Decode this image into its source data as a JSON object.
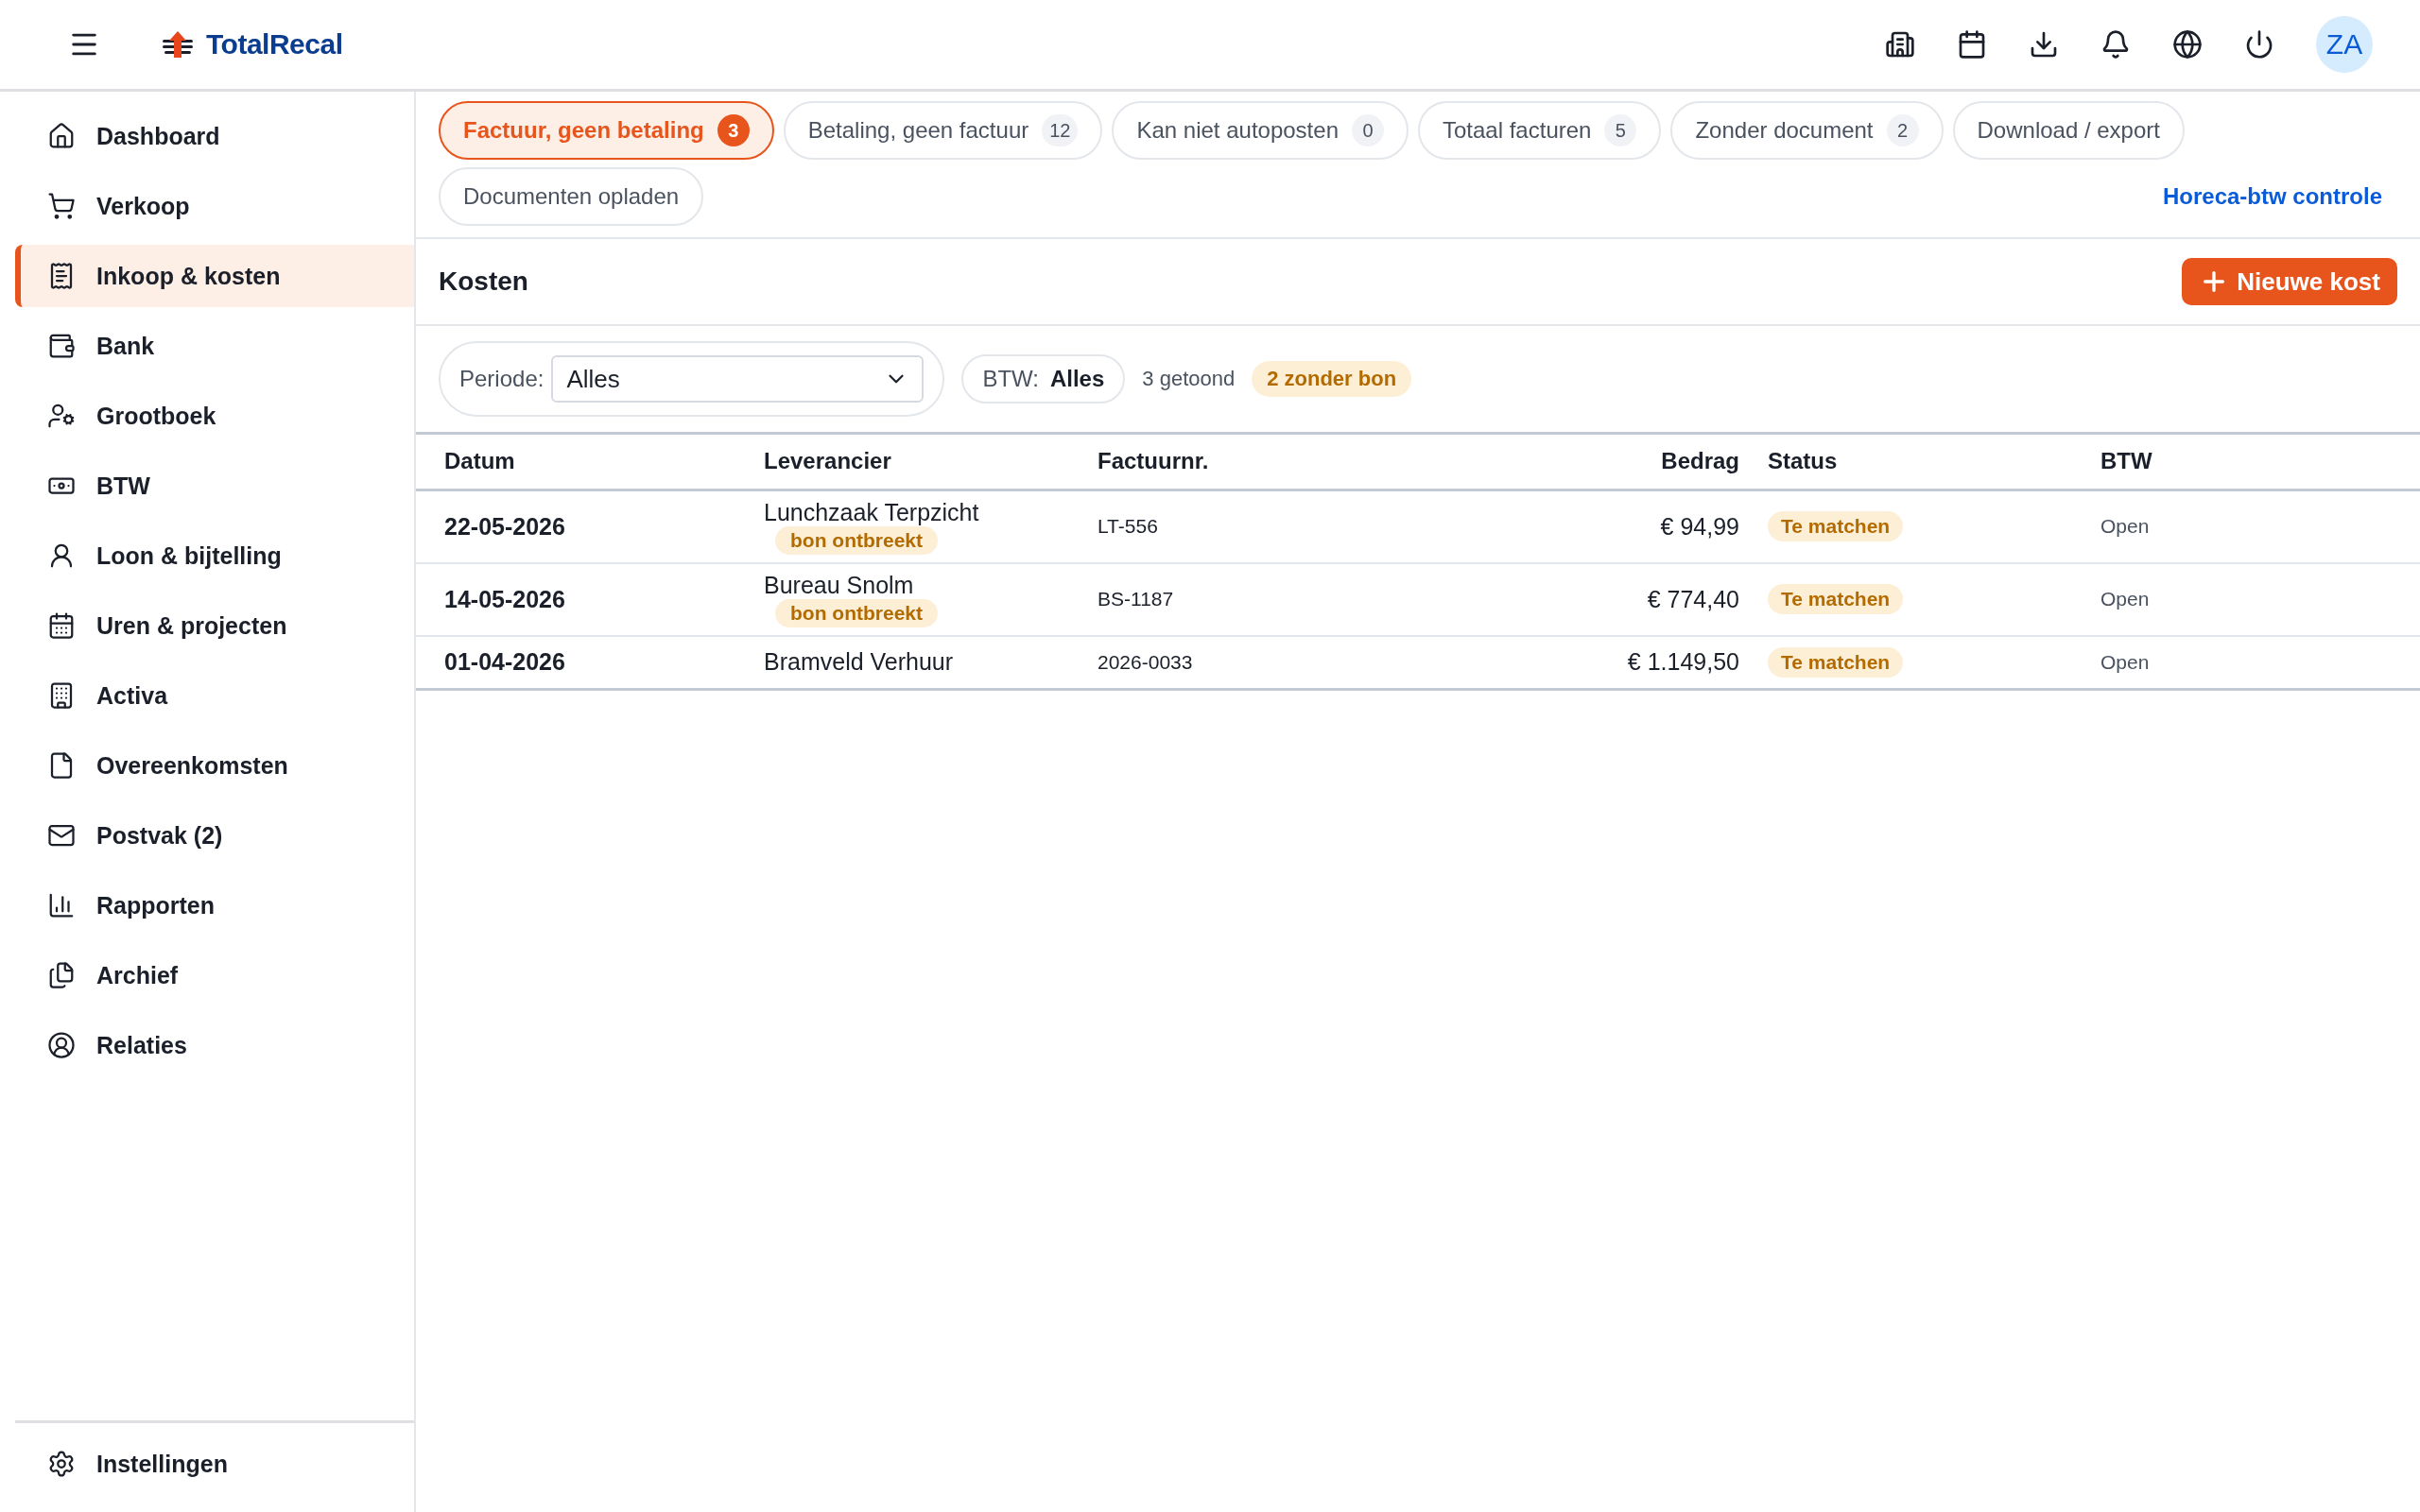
{
  "brand": {
    "name": "TotalRecal"
  },
  "user": {
    "initials": "ZA"
  },
  "sidebar": {
    "items": [
      {
        "label": "Dashboard",
        "selected": false
      },
      {
        "label": "Verkoop",
        "selected": false
      },
      {
        "label": "Inkoop & kosten",
        "selected": true
      },
      {
        "label": "Bank",
        "selected": false
      },
      {
        "label": "Grootboek",
        "selected": false
      },
      {
        "label": "BTW",
        "selected": false
      },
      {
        "label": "Loon & bijtelling",
        "selected": false
      },
      {
        "label": "Uren & projecten",
        "selected": false
      },
      {
        "label": "Activa",
        "selected": false
      },
      {
        "label": "Overeenkomsten",
        "selected": false
      },
      {
        "label": "Postvak (2)",
        "selected": false
      },
      {
        "label": "Rapporten",
        "selected": false
      },
      {
        "label": "Archief",
        "selected": false
      },
      {
        "label": "Relaties",
        "selected": false
      }
    ],
    "footer_item": {
      "label": "Instellingen"
    }
  },
  "tabs": [
    {
      "label": "Factuur, geen betaling",
      "count": "3",
      "selected": true
    },
    {
      "label": "Betaling, geen factuur",
      "count": "12",
      "selected": false
    },
    {
      "label": "Kan niet autoposten",
      "count": "0",
      "selected": false
    },
    {
      "label": "Totaal facturen",
      "count": "5",
      "selected": false
    },
    {
      "label": "Zonder document",
      "count": "2",
      "selected": false
    },
    {
      "label": "Download / export",
      "selected": false
    },
    {
      "label": "Documenten opladen",
      "selected": false
    }
  ],
  "tabs_link": "Horeca-btw controle",
  "section": {
    "title": "Kosten",
    "button": "Nieuwe kost"
  },
  "filters": {
    "period_label": "Periode:",
    "period_value": "Alles",
    "btw_label": "BTW:",
    "btw_value": "Alles",
    "shown": "3 getoond",
    "missing_badge": "2 zonder bon"
  },
  "table": {
    "columns": [
      "Datum",
      "Leverancier",
      "Factuurnr.",
      "Bedrag",
      "Status",
      "BTW"
    ],
    "rows": [
      {
        "date": "22-05-2026",
        "supplier": "Lunchzaak Terpzicht",
        "tag": "bon ontbreekt",
        "invoice": "LT-556",
        "amount": "€ 94,99",
        "status": "Te matchen",
        "btw": "Open"
      },
      {
        "date": "14-05-2026",
        "supplier": "Bureau Snolm",
        "tag": "bon ontbreekt",
        "invoice": "BS-1187",
        "amount": "€ 774,40",
        "status": "Te matchen",
        "btw": "Open"
      },
      {
        "date": "01-04-2026",
        "supplier": "Bramveld Verhuur",
        "invoice": "2026-0033",
        "amount": "€ 1.149,50",
        "status": "Te matchen",
        "btw": "Open"
      }
    ]
  }
}
